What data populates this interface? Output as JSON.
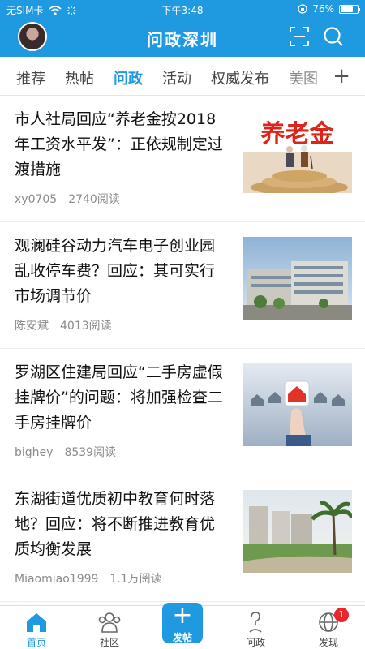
{
  "status_bar": {
    "carrier": "无SIM卡",
    "time": "下午3:48",
    "battery": "76%",
    "battery_level": 0.76
  },
  "header": {
    "title": "问政深圳",
    "avatar_icon": "user-avatar",
    "scan_icon": "scan-icon",
    "search_icon": "search-icon"
  },
  "tabs": [
    {
      "label": "推荐",
      "active": false
    },
    {
      "label": "热帖",
      "active": false
    },
    {
      "label": "问政",
      "active": true
    },
    {
      "label": "活动",
      "active": false
    },
    {
      "label": "权威发布",
      "active": false
    },
    {
      "label": "美图",
      "active": false
    }
  ],
  "tab_add": "+",
  "articles": [
    {
      "title": "市人社局回应“养老金按2018年工资水平发”：正依规制定过渡措施",
      "author": "xy0705",
      "reads": "2740阅读",
      "thumb_text": "养老金"
    },
    {
      "title": "观澜硅谷动力汽车电子创业园乱收停车费？回应：其可实行市场调节价",
      "author": "陈安斌",
      "reads": "4013阅读"
    },
    {
      "title": "罗湖区住建局回应“二手房虚假挂牌价”的问题：将加强检查二手房挂牌价",
      "author": "bighey",
      "reads": "8539阅读"
    },
    {
      "title": "东湖街道优质初中教育何时落地？回应：将不断推进教育优质均衡发展",
      "author": "Miaomiao1999",
      "reads": "1.1万阅读"
    }
  ],
  "tabbar": {
    "home": "首页",
    "community": "社区",
    "post_plus": "+",
    "post": "发帖",
    "wenzheng": "问政",
    "discover": "发现",
    "discover_badge": "1"
  },
  "colors": {
    "brand": "#1f9ae0",
    "badge": "#e8262c"
  }
}
